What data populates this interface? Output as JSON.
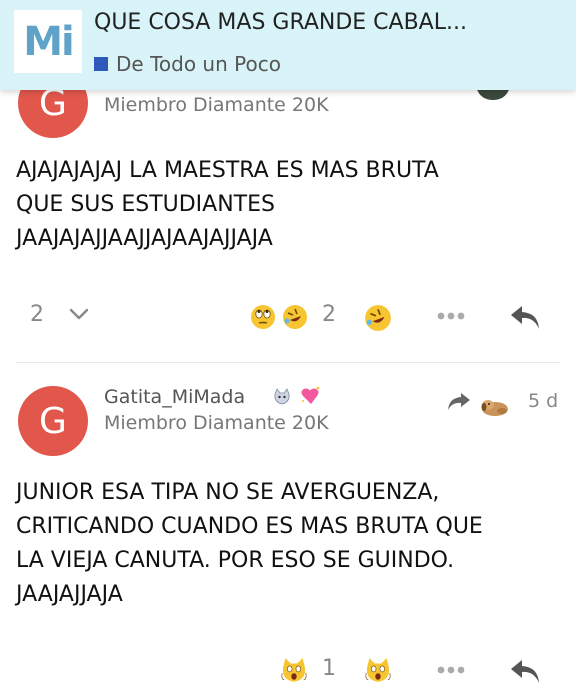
{
  "header": {
    "logo": "Mi",
    "title": "QUE COSA MAS GRANDE CABAL...",
    "category": "De Todo un Poco",
    "category_color": "#2e59b8"
  },
  "posts": [
    {
      "avatar_letter": "G",
      "user_title": "Miembro Diamante 20K",
      "body_lines": [
        "AJAJAJAJAJ LA MAESTRA ES MAS BRUTA",
        "QUE SUS ESTUDIANTES",
        "JAAJAJAJJAAJJAJAAJAJJAJA"
      ],
      "replies_count": "2",
      "likes_count": "2"
    },
    {
      "avatar_letter": "G",
      "username": "Gatita_MiMada",
      "user_title": "Miembro Diamante 20K",
      "time": "5 d",
      "body_lines": [
        "JUNIOR ESA TIPA NO SE AVERGUENZA,",
        "CRITICANDO CUANDO ES MAS BRUTA QUE",
        "LA VIEJA CANUTA. POR ESO SE GUINDO.",
        "JAAJAJJAJA"
      ],
      "likes_count": "1"
    }
  ],
  "icons": {
    "expand": "chevron-down-icon",
    "more": "more-dots-icon",
    "reply": "reply-arrow-icon",
    "reply_to": "reply-to-arrow-icon"
  },
  "colors": {
    "header_bg": "#d9f4f8",
    "avatar": "#e2574c"
  }
}
